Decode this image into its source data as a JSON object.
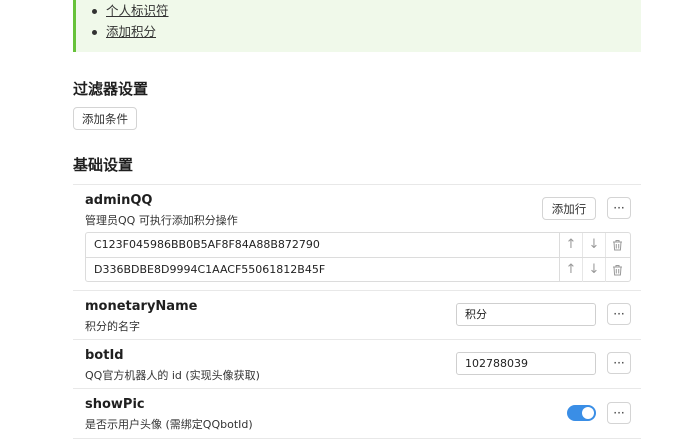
{
  "notice": {
    "links": [
      "个人标识符",
      "添加积分"
    ]
  },
  "filter": {
    "title": "过滤器设置",
    "add_condition_label": "添加条件"
  },
  "basic": {
    "title": "基础设置",
    "more_label": "···",
    "adminQQ": {
      "name": "adminQQ",
      "desc": "管理员QQ 可执行添加积分操作",
      "add_row_label": "添加行",
      "rows": [
        "C123F045986BB0B5AF8F84A88B872790",
        "D336BDBE8D9994C1AACF55061812B45F"
      ],
      "up_glyph": "↑",
      "down_glyph": "↓",
      "delete_glyph": "🗑"
    },
    "monetaryName": {
      "name": "monetaryName",
      "desc": "积分的名字",
      "value": "积分"
    },
    "botId": {
      "name": "botId",
      "desc": "QQ官方机器人的 id (实现头像获取)",
      "value": "102788039"
    },
    "showPic": {
      "name": "showPic",
      "desc": "是否示用户头像 (需绑定QQbotId)",
      "enabled": true
    }
  },
  "colors": {
    "accent": "#3a8ee6",
    "notice_border": "#67c23a",
    "notice_bg": "#f0f9ea"
  }
}
